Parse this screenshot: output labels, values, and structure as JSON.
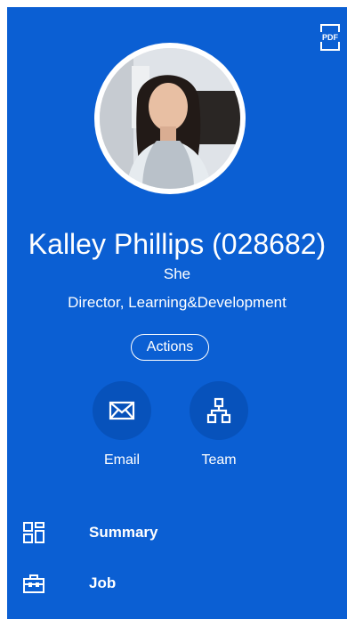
{
  "profile": {
    "name": "Kalley Phillips (028682)",
    "pronoun": "She",
    "title": "Director, Learning&Development"
  },
  "toolbar": {
    "pdf_icon": "pdf-icon",
    "pdf_label": "PDF"
  },
  "actions_label": "Actions",
  "quick_actions": [
    {
      "label": "Email",
      "icon": "envelope-icon"
    },
    {
      "label": "Team",
      "icon": "org-chart-icon"
    }
  ],
  "nav": [
    {
      "label": "Summary",
      "icon": "grid-icon"
    },
    {
      "label": "Job",
      "icon": "briefcase-icon"
    }
  ],
  "colors": {
    "background": "#0b5fd3",
    "circle_button": "#0752bb",
    "text": "#ffffff"
  }
}
